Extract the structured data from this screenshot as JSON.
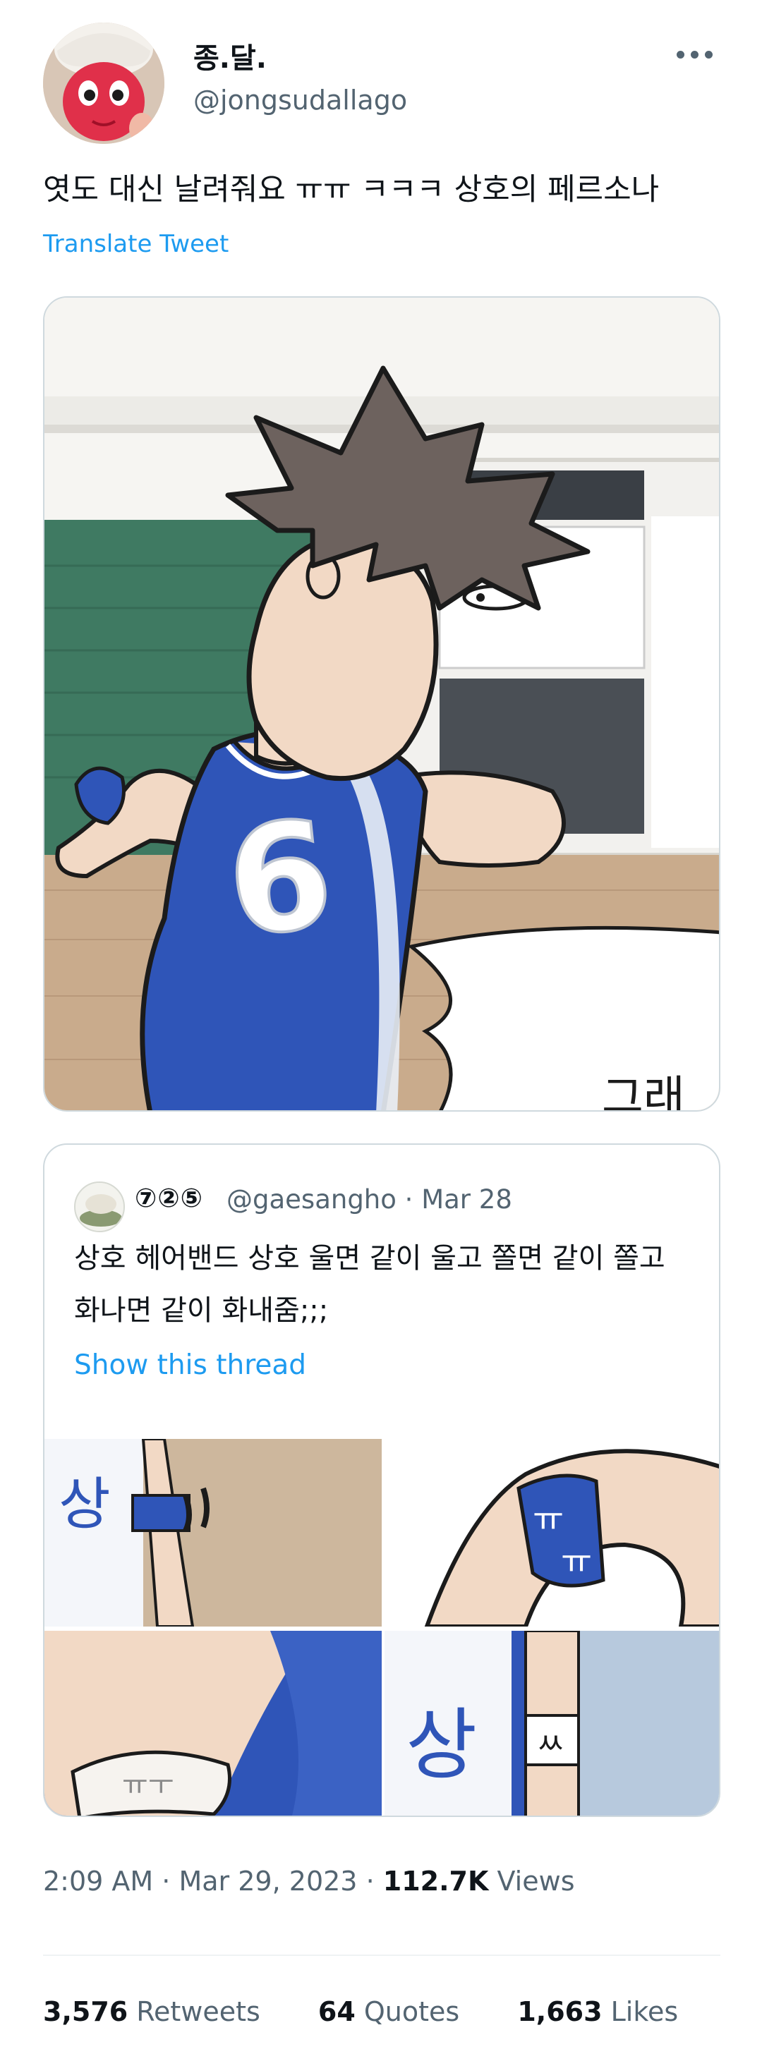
{
  "author": {
    "display_name": "종.달.",
    "handle": "@jongsudallago"
  },
  "tweet": {
    "text": "엿도 대신 날려줘요 ㅠㅠ ㅋㅋㅋ 상호의 페르소나",
    "translate_label": "Translate Tweet"
  },
  "media": {
    "jersey_number": "6",
    "corner_text": "그래"
  },
  "quote": {
    "display_name": "⑦②⑤",
    "handle": "@gaesangho",
    "separator": "·",
    "date": "Mar 28",
    "text": "상호 헤어밴드 상호 울면 같이 울고 쫄면 같이 쫄고 화나면 같이 화내줌;;;",
    "show_thread": "Show this thread",
    "image_texts": {
      "top_left": "상",
      "top_right_1": "ㅠ",
      "top_right_2": "ㅠ",
      "bottom_left": "ㅠㅜ",
      "bottom_right_1": "상",
      "bottom_right_2": "ㅆ"
    }
  },
  "meta": {
    "time": "2:09 AM",
    "sep1": "·",
    "date": "Mar 29, 2023",
    "sep2": "·",
    "views_count": "112.7K",
    "views_label": "Views"
  },
  "stats": {
    "retweets_count": "3,576",
    "retweets_label": "Retweets",
    "quotes_count": "64",
    "quotes_label": "Quotes",
    "likes_count": "1,663",
    "likes_label": "Likes"
  },
  "colors": {
    "link": "#1d9bf0",
    "secondary": "#536471",
    "jersey_blue": "#2f55b8"
  }
}
